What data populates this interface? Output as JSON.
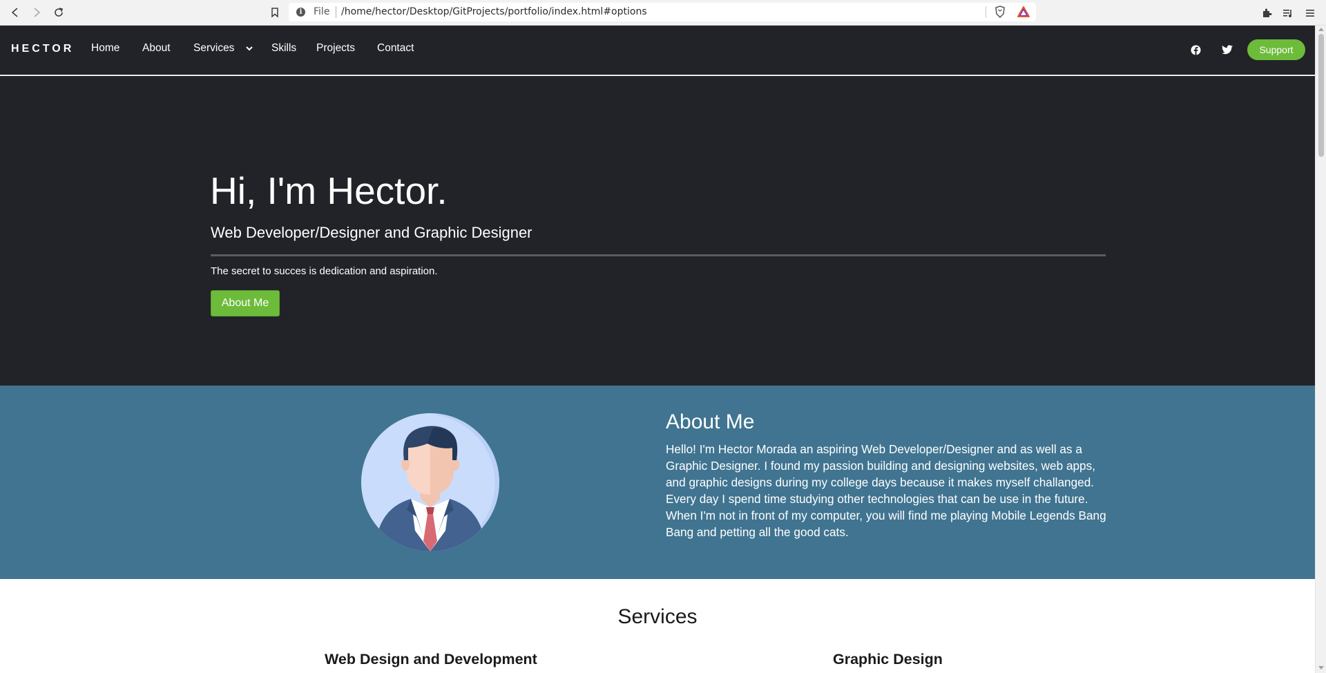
{
  "browser": {
    "back_icon": "back-arrow-icon",
    "forward_icon": "forward-arrow-icon",
    "reload_icon": "reload-icon",
    "bookmark_icon": "bookmark-icon",
    "url_scheme": "File",
    "url": "/home/hector/Desktop/GitProjects/portfolio/index.html#options"
  },
  "navbar": {
    "brand": "HECTOR",
    "links": [
      "Home",
      "About",
      "Services",
      "Skills",
      "Projects",
      "Contact"
    ],
    "support_label": "Support"
  },
  "hero": {
    "title": "Hi, I'm Hector.",
    "subtitle": "Web Developer/Designer and Graphic Designer",
    "tagline": "The secret to succes is dedication and aspiration.",
    "button_label": "About Me"
  },
  "about": {
    "title": "About Me",
    "text": "Hello! I'm Hector Morada an aspiring Web Developer/Designer and as well as a Graphic Designer. I found my passion building and designing websites, web apps, and graphic designs during my college days because it makes myself challanged. Every day I spend time studying other technologies that can be use in the future. When I'm not in front of my computer, you will find me playing Mobile Legends Bang Bang and petting all the good cats."
  },
  "services": {
    "title": "Services",
    "items": [
      "Web Design and Development",
      "Graphic Design"
    ]
  },
  "colors": {
    "dark_bg": "#222328",
    "about_bg": "#407490",
    "accent_green": "#6dbb3b"
  }
}
